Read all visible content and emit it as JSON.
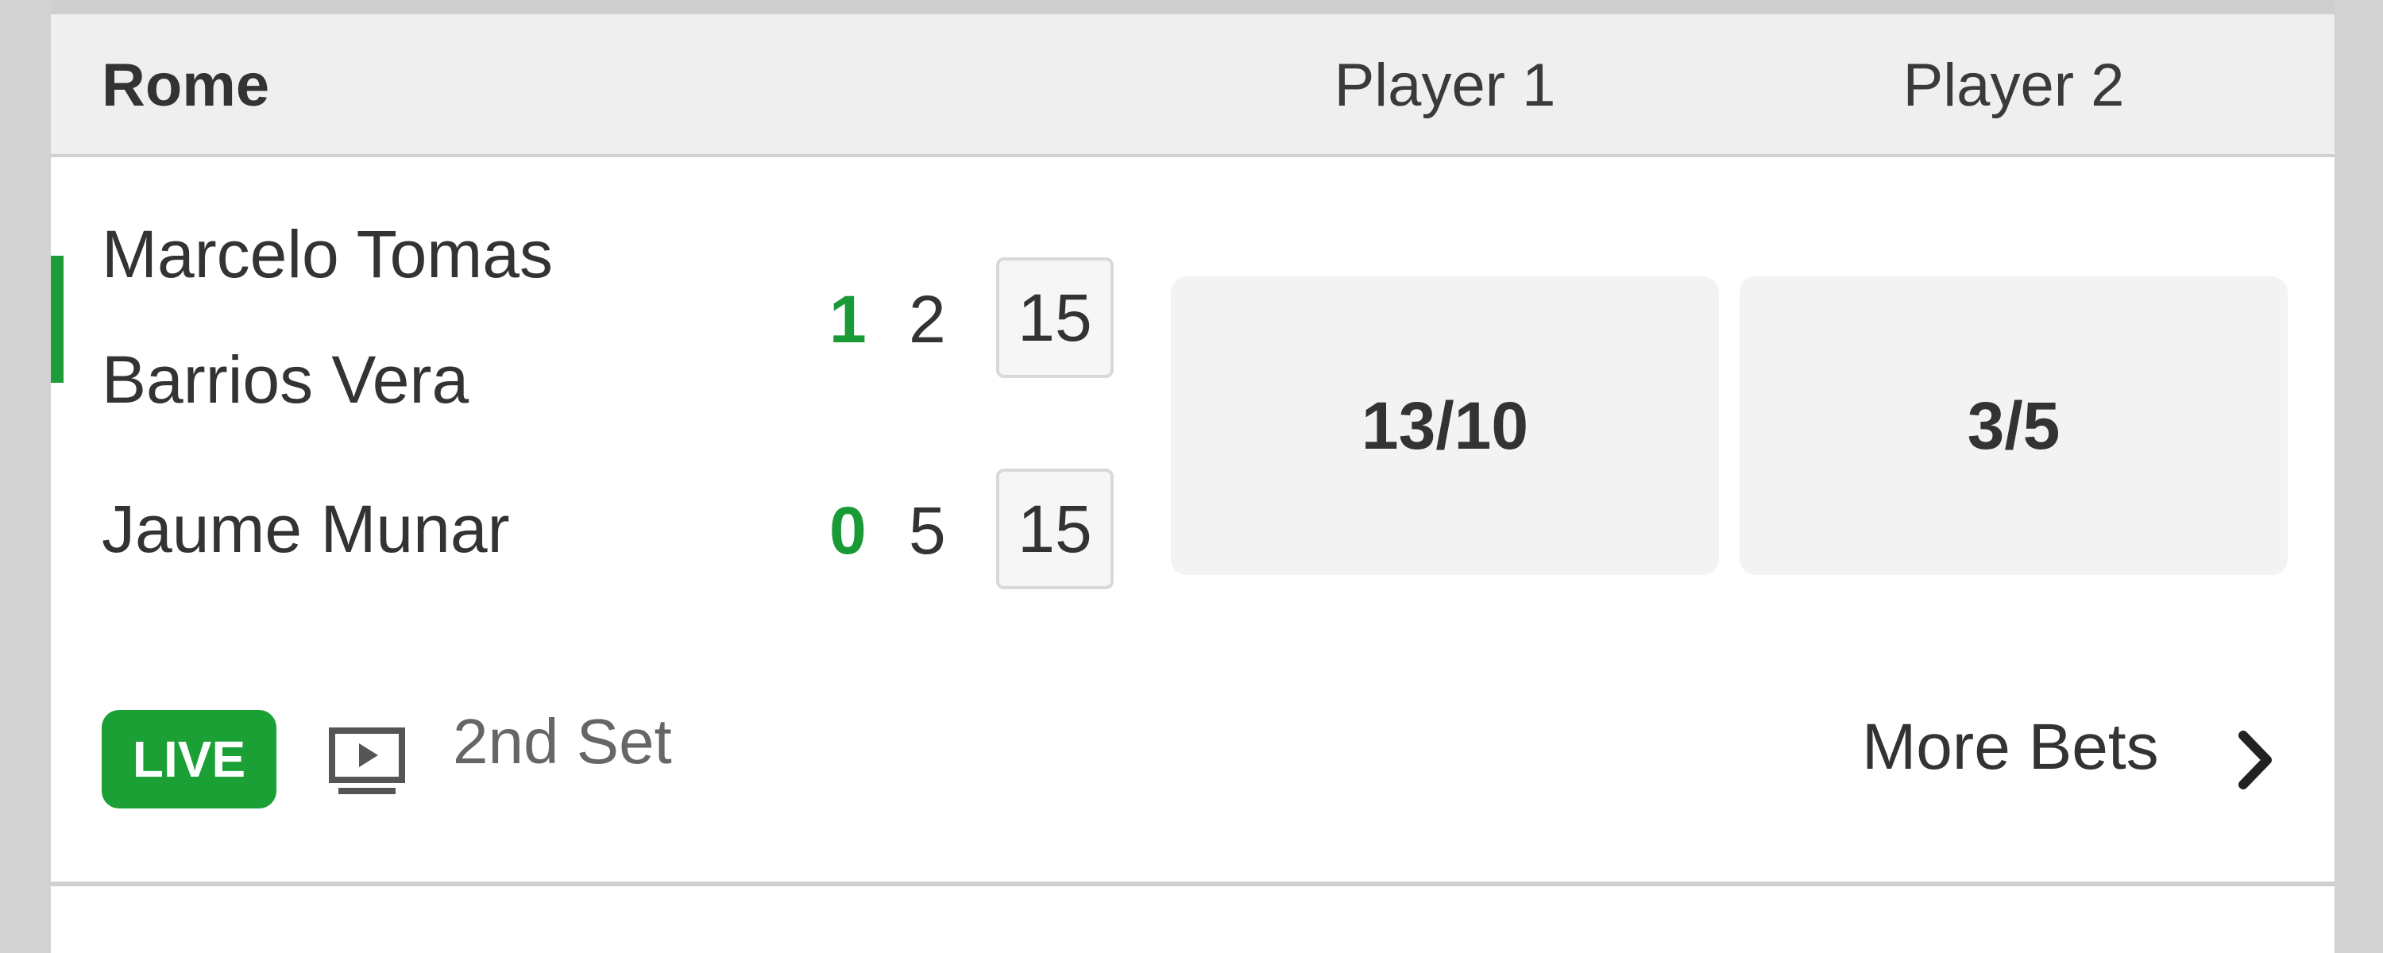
{
  "header": {
    "tournament": "Rome",
    "player1_label": "Player 1",
    "player2_label": "Player 2"
  },
  "match": {
    "players": [
      {
        "name_line1": "Marcelo Tomas",
        "name_line2": "Barrios Vera",
        "sets": "1",
        "games": "2",
        "points": "15"
      },
      {
        "name_line1": "Jaume Munar",
        "sets": "0",
        "games": "5",
        "points": "15"
      }
    ],
    "odds": [
      "13/10",
      "3/5"
    ],
    "status_badge": "LIVE",
    "period": "2nd Set",
    "more_bets_label": "More Bets",
    "icons": [
      "tv-play-icon",
      "chevron-right-icon"
    ],
    "accent_color": "#1aa035"
  }
}
